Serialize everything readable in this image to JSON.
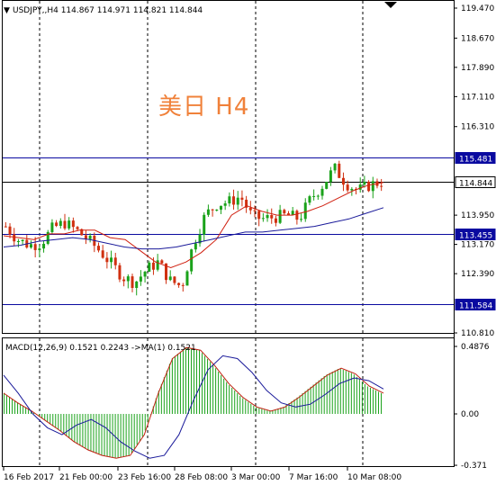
{
  "main_chart": {
    "header": "USDJPY,,H4  114.867 114.971 114.821 114.844",
    "title_overlay": "美日 H4",
    "price_axis": [
      "119.470",
      "118.670",
      "117.890",
      "117.110",
      "116.310",
      "115.481",
      "114.844",
      "113.950",
      "113.455",
      "113.170",
      "112.390",
      "111.584",
      "110.810"
    ],
    "h_lines": [
      {
        "value": 115.481,
        "label": "115.481",
        "color": "#0a0aa0"
      },
      {
        "value": 114.844,
        "label": "114.844",
        "color": "#000000"
      },
      {
        "value": 113.455,
        "label": "113.455",
        "color": "#0a0aa0"
      },
      {
        "value": 111.584,
        "label": "111.584",
        "color": "#0a0aa0"
      }
    ]
  },
  "macd_panel": {
    "header": "MACD(12,26,9) 0.1521 0.2243  ->MA(1) 0.1521",
    "axis": [
      "0.4876",
      "0.00",
      "-0.371"
    ]
  },
  "time_axis": [
    "16 Feb 2017",
    "21 Feb 00:00",
    "23 Feb 16:00",
    "28 Feb 08:00",
    "3 Mar 00:00",
    "7 Mar 16:00",
    "10 Mar 08:00"
  ],
  "colors": {
    "bull": "#1aa21a",
    "bear": "#d03010",
    "ma_fast": "#d02010",
    "ma_slow": "#1a1a9a",
    "hline": "#0a0aa0",
    "macd_hist": "#1aa21a",
    "macd_line": "#1a1a9a",
    "signal_line": "#c02010",
    "title": "#f0813a"
  },
  "chart_data": {
    "type": "candlestick",
    "symbol": "USDJPY",
    "timeframe": "H4",
    "ylim": [
      110.81,
      119.47
    ],
    "x": [
      "16 Feb 2017",
      "21 Feb 00:00",
      "23 Feb 16:00",
      "28 Feb 08:00",
      "3 Mar 00:00",
      "7 Mar 16:00",
      "10 Mar 08:00"
    ],
    "series": [
      {
        "values": [
          113.65,
          113.3,
          113.15,
          113.2,
          113.6,
          113.75,
          113.55,
          113.3,
          113.0,
          112.65,
          112.3,
          112.15,
          112.5,
          112.7,
          112.2,
          112.05,
          113.2,
          113.95,
          114.25,
          114.3,
          114.45,
          113.9,
          113.85,
          113.9,
          113.95,
          113.85,
          114.4,
          114.75,
          115.2,
          114.8,
          114.6,
          114.75,
          114.84
        ]
      },
      {
        "values": [
          113.4,
          113.35,
          113.3,
          113.45,
          113.45,
          113.55,
          113.55,
          113.35,
          113.3,
          113.0,
          112.7,
          112.55,
          112.7,
          112.95,
          113.3,
          113.95,
          114.2,
          114.05,
          113.95,
          113.95,
          114.05,
          114.2,
          114.4,
          114.6,
          114.75,
          114.82
        ]
      },
      {
        "values": [
          113.1,
          113.15,
          113.25,
          113.3,
          113.35,
          113.3,
          113.2,
          113.1,
          113.05,
          113.05,
          113.1,
          113.2,
          113.3,
          113.4,
          113.5,
          113.5,
          113.55,
          113.6,
          113.65,
          113.75,
          113.85,
          114.0,
          114.15
        ]
      },
      {
        "values": [
          0.15,
          0.08,
          0.02,
          -0.05,
          -0.12,
          -0.2,
          -0.26,
          -0.3,
          -0.32,
          -0.3,
          -0.15,
          0.15,
          0.4,
          0.48,
          0.46,
          0.35,
          0.22,
          0.12,
          0.05,
          0.02,
          0.05,
          0.12,
          0.2,
          0.28,
          0.33,
          0.29,
          0.2,
          0.15
        ]
      },
      {
        "values": [
          0.28,
          0.15,
          0.0,
          -0.1,
          -0.15,
          -0.08,
          -0.04,
          -0.1,
          -0.2,
          -0.27,
          -0.32,
          -0.3,
          -0.15,
          0.1,
          0.32,
          0.42,
          0.4,
          0.3,
          0.17,
          0.08,
          0.05,
          0.07,
          0.14,
          0.22,
          0.26,
          0.24,
          0.18
        ]
      }
    ]
  }
}
